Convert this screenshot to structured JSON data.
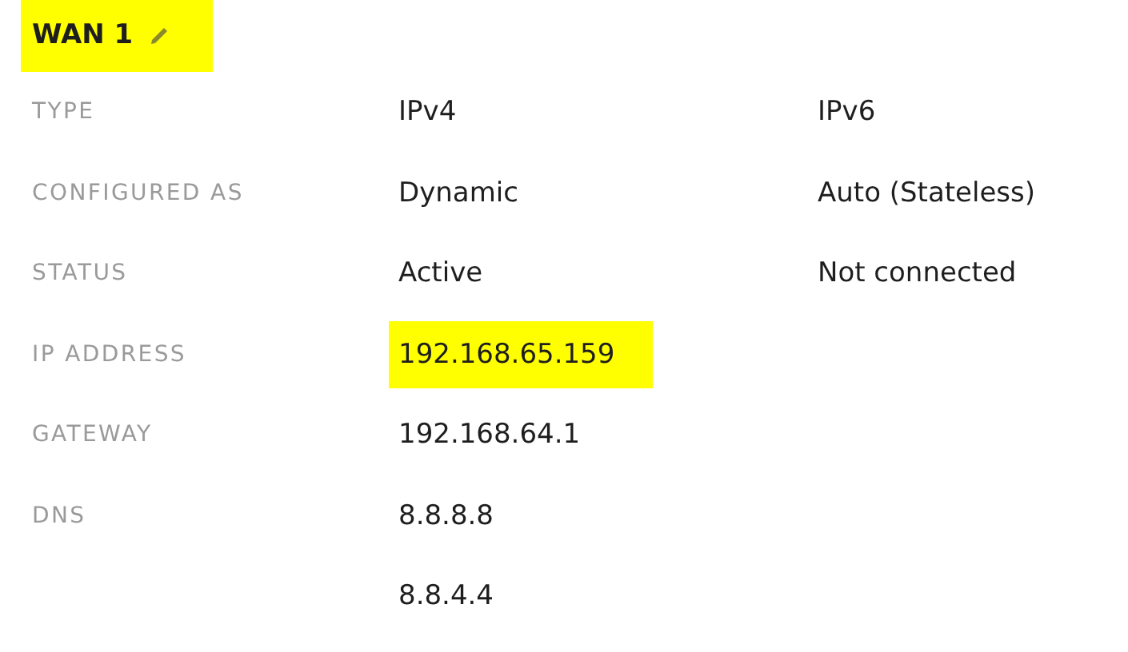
{
  "title": {
    "text": "WAN 1",
    "highlighted": true
  },
  "rows": [
    {
      "label": "TYPE",
      "values": [
        {
          "text": "IPv4",
          "highlighted": false
        },
        {
          "text": "IPv6",
          "highlighted": false
        }
      ]
    },
    {
      "label": "CONFIGURED AS",
      "values": [
        {
          "text": "Dynamic",
          "highlighted": false
        },
        {
          "text": "Auto (Stateless)",
          "highlighted": false
        }
      ]
    },
    {
      "label": "STATUS",
      "values": [
        {
          "text": "Active",
          "highlighted": false
        },
        {
          "text": "Not connected",
          "highlighted": false
        }
      ]
    },
    {
      "label": "IP ADDRESS",
      "values": [
        {
          "text": "192.168.65.159",
          "highlighted": true
        }
      ]
    },
    {
      "label": "GATEWAY",
      "values": [
        {
          "text": "192.168.64.1",
          "highlighted": false
        }
      ]
    },
    {
      "label": "DNS",
      "values": [
        {
          "text": "8.8.8.8",
          "highlighted": false
        }
      ]
    },
    {
      "values": [
        {
          "text": "8.8.4.4",
          "highlighted": false
        }
      ]
    }
  ]
}
